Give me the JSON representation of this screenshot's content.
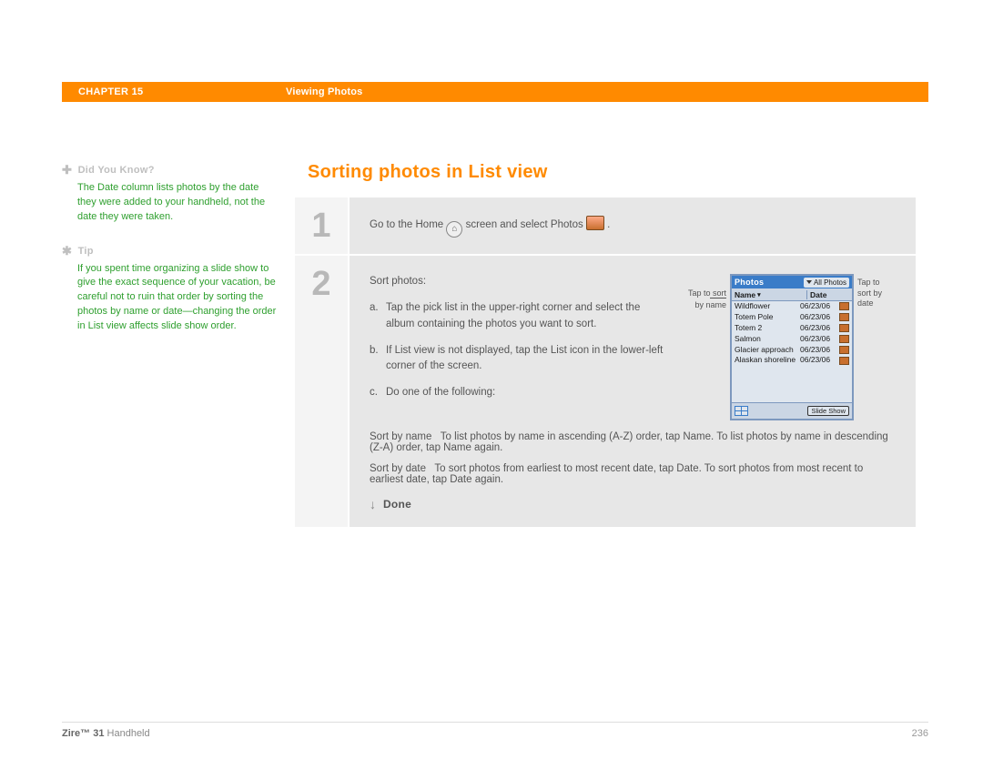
{
  "header": {
    "chapter": "CHAPTER 15",
    "section": "Viewing Photos"
  },
  "sidebar": {
    "didyouknow": {
      "title": "Did You Know?",
      "body": "The Date column lists photos by the date they were added to your handheld, not the date they were taken."
    },
    "tip": {
      "title": "Tip",
      "body": "If you spent time organizing a slide show to give the exact sequence of your vacation, be careful not to ruin that order by sorting the photos by name or date—changing the order in List view affects slide show order."
    }
  },
  "main": {
    "title": "Sorting photos in List view",
    "step1": {
      "pre": "Go to the Home ",
      "mid": " screen and select Photos ",
      "end": "."
    },
    "step2": {
      "intro": "Sort photos:",
      "a": "Tap the pick list in the upper-right corner and select the album containing the photos you want to sort.",
      "b": "If List view is not displayed, tap the List icon in the lower-left corner of the screen.",
      "c": "Do one of the following:",
      "sortbyname_lbl": "Sort by name",
      "sortbyname_txt": "To list photos by name in ascending (A-Z) order, tap Name. To list photos by name in descending (Z-A) order, tap Name again.",
      "sortbydate_lbl": "Sort by date",
      "sortbydate_txt": "To sort photos from earliest to most recent date, tap Date. To sort photos from most recent to earliest date, tap Date again.",
      "done": "Done"
    },
    "callout_left_l1": "Tap to sort",
    "callout_left_l2": "by name",
    "callout_right_l1": "Tap to",
    "callout_right_l2": "sort by",
    "callout_right_l3": "date",
    "screen": {
      "title": "Photos",
      "dropdown": "All Photos",
      "col_name": "Name",
      "col_date": "Date",
      "items": [
        {
          "n": "Wildflower",
          "d": "06/23/06"
        },
        {
          "n": "Totem Pole",
          "d": "06/23/06"
        },
        {
          "n": "Totem 2",
          "d": "06/23/06"
        },
        {
          "n": "Salmon",
          "d": "06/23/06"
        },
        {
          "n": "Glacier approach",
          "d": "06/23/06"
        },
        {
          "n": "Alaskan shoreline",
          "d": "06/23/06"
        }
      ],
      "slideshow": "Slide Show"
    }
  },
  "footer": {
    "product_bold": "Zire™ 31",
    "product_rest": " Handheld",
    "page": "236"
  }
}
